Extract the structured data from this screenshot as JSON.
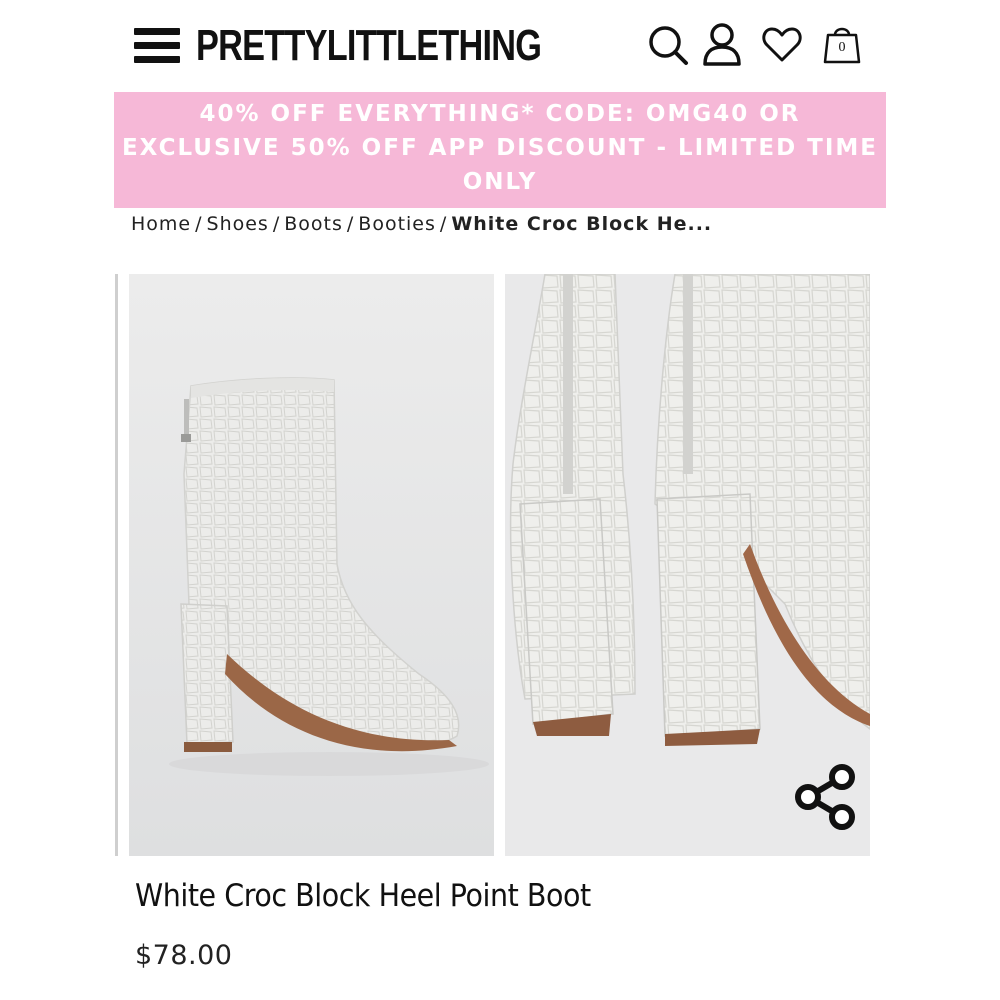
{
  "header": {
    "logo": "PRETTYLITTLETHING",
    "icons": [
      "menu-icon",
      "search-icon",
      "account-icon",
      "wishlist-heart-icon",
      "shopping-bag-icon"
    ],
    "bag_count": "0"
  },
  "promo": {
    "line1": "40% OFF EVERYTHING* CODE: OMG40 OR",
    "line2": "EXCLUSIVE 50% OFF APP DISCOUNT - LIMITED TIME",
    "line3": "ONLY",
    "background": "#f6b8d7",
    "text_color": "#ffffff"
  },
  "breadcrumb": {
    "items": [
      "Home",
      "Shoes",
      "Boots",
      "Booties"
    ],
    "separator": "/",
    "current": "White Croc Block He..."
  },
  "gallery": {
    "images": [
      "boot-side-view",
      "boot-heel-back-view"
    ],
    "share_icon": "share-icon"
  },
  "product": {
    "title": "White Croc Block Heel Point Boot",
    "price": "$78.00"
  }
}
